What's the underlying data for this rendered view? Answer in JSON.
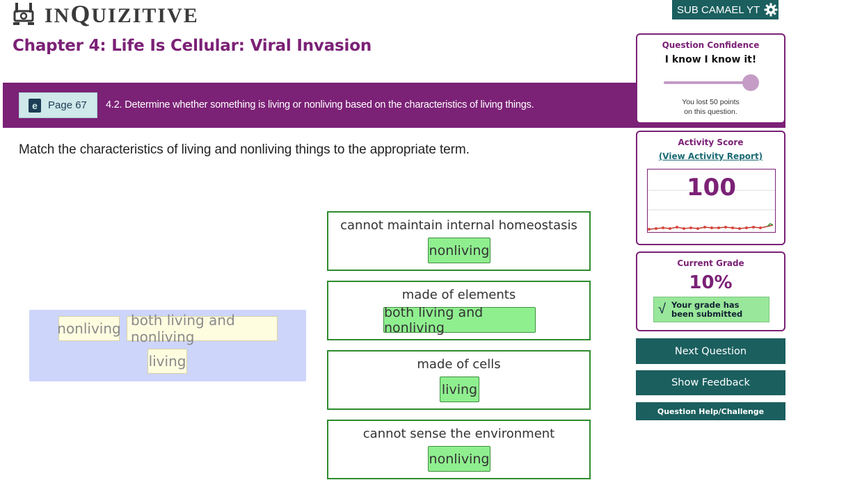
{
  "header": {
    "app_title_big": "Q",
    "app_title_pre": "IN",
    "app_title_post": "UIZITIVE",
    "user_label": "SUB CAMAEL YT",
    "chapter_title": "Chapter 4: Life Is Cellular: Viral Invasion"
  },
  "banner": {
    "page_label": "Page 67",
    "objective": "4.2. Determine whether something is living or nonliving based on the characteristics of living things."
  },
  "question": {
    "prompt": "Match the characteristics of living and nonliving things to the appropriate term."
  },
  "word_bank": [
    "nonliving",
    "both living and nonliving",
    "living"
  ],
  "targets": [
    {
      "label": "cannot maintain internal homeostasis",
      "answer": "nonliving"
    },
    {
      "label": "made of elements",
      "answer": "both living and nonliving"
    },
    {
      "label": "made of cells",
      "answer": "living"
    },
    {
      "label": "cannot sense the environment",
      "answer": "nonliving"
    }
  ],
  "sidebar": {
    "confidence_title": "Question Confidence",
    "confidence_value": "I know I know it!",
    "confidence_level": 1.0,
    "lost_line1": "You lost 50 points",
    "lost_line2": "on this question.",
    "score_title": "Activity Score",
    "report_link": "(View Activity Report)",
    "score_value": "100",
    "grade_title": "Current Grade",
    "grade_value": "10%",
    "grade_submitted_line1": "Your grade has",
    "grade_submitted_line2": "been submitted",
    "next_button": "Next Question",
    "feedback_button": "Show Feedback",
    "help_button": "Question Help/Challenge"
  },
  "colors": {
    "brand_purple": "#7b2176",
    "action_teal": "#1b5f5f",
    "correct_green": "#8fef8f",
    "bank_blue": "#cdd5fb"
  }
}
